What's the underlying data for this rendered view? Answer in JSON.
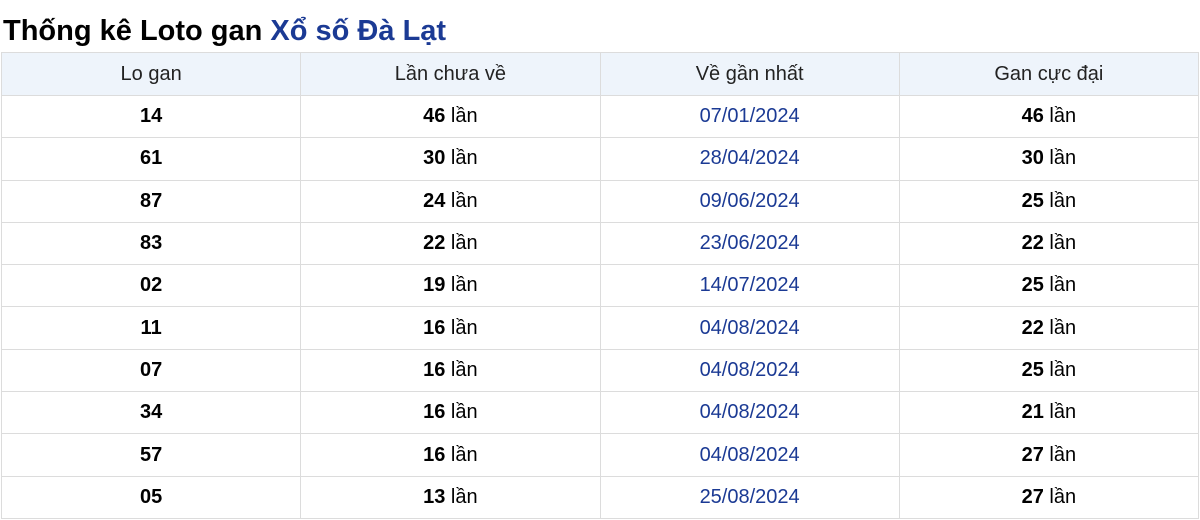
{
  "heading": {
    "prefix": "Thống kê Loto gan",
    "link": "Xổ số Đà Lạt"
  },
  "table": {
    "columns": [
      "Lo gan",
      "Lần chưa về",
      "Về gần nhất",
      "Gan cực đại"
    ],
    "unit": "lần",
    "rows": [
      {
        "lo": "14",
        "missed": "46",
        "last": "07/01/2024",
        "max": "46"
      },
      {
        "lo": "61",
        "missed": "30",
        "last": "28/04/2024",
        "max": "30"
      },
      {
        "lo": "87",
        "missed": "24",
        "last": "09/06/2024",
        "max": "25"
      },
      {
        "lo": "83",
        "missed": "22",
        "last": "23/06/2024",
        "max": "22"
      },
      {
        "lo": "02",
        "missed": "19",
        "last": "14/07/2024",
        "max": "25"
      },
      {
        "lo": "11",
        "missed": "16",
        "last": "04/08/2024",
        "max": "22"
      },
      {
        "lo": "07",
        "missed": "16",
        "last": "04/08/2024",
        "max": "25"
      },
      {
        "lo": "34",
        "missed": "16",
        "last": "04/08/2024",
        "max": "21"
      },
      {
        "lo": "57",
        "missed": "16",
        "last": "04/08/2024",
        "max": "27"
      },
      {
        "lo": "05",
        "missed": "13",
        "last": "25/08/2024",
        "max": "27"
      }
    ]
  },
  "colors": {
    "link": "#1b3a94",
    "header_bg": "#eef4fb",
    "border": "#dcdcdc"
  }
}
